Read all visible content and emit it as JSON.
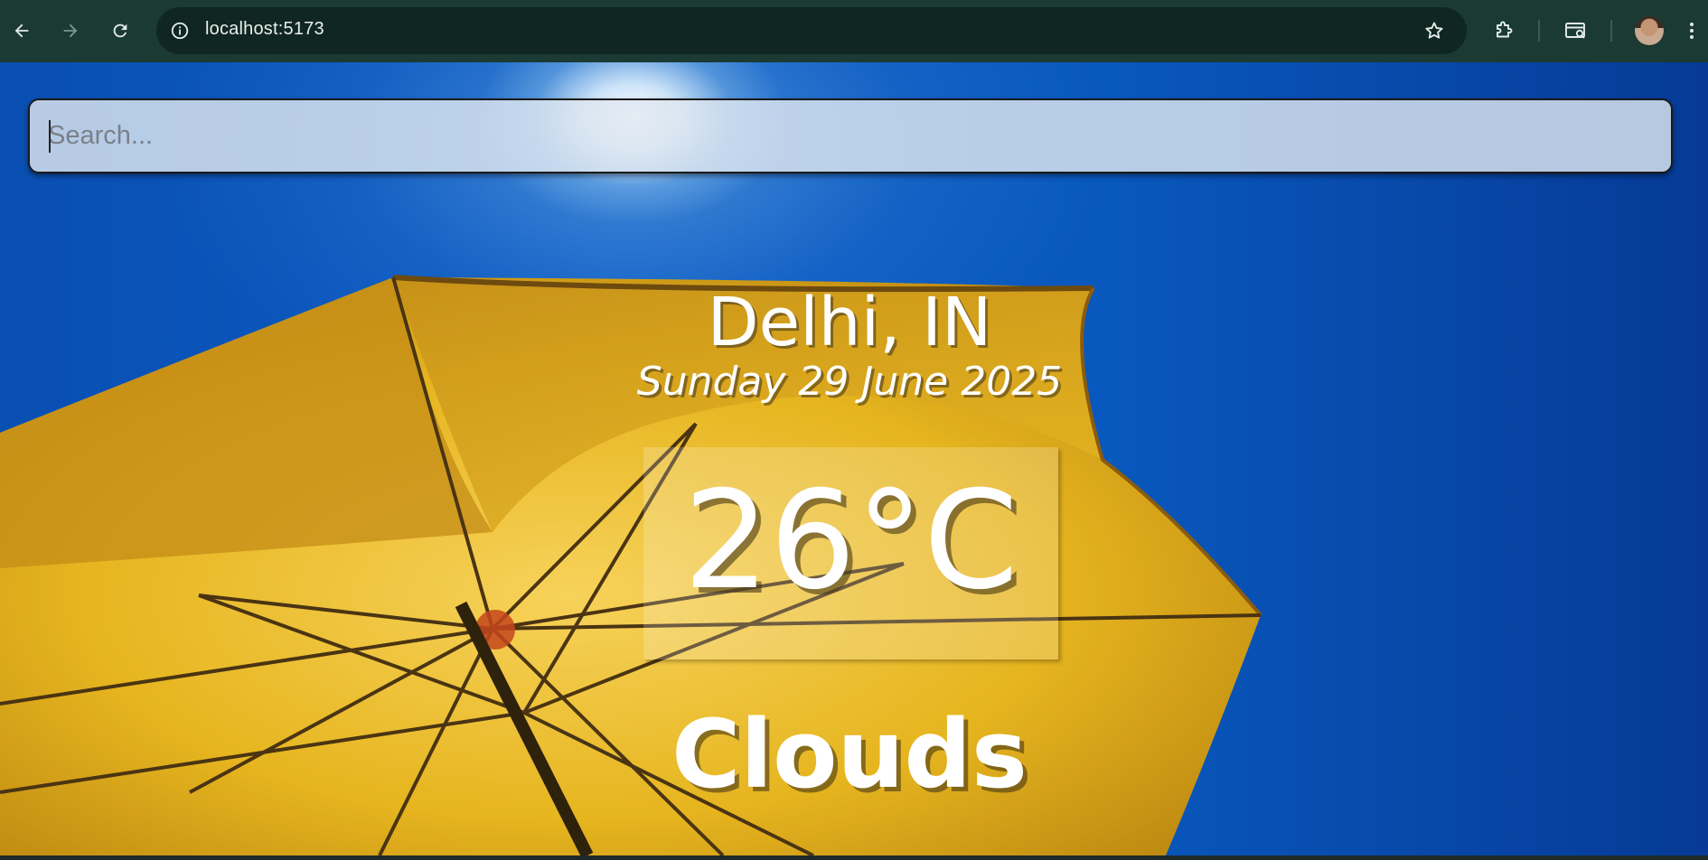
{
  "browser": {
    "url": "localhost:5173",
    "nav": {
      "back_icon": "arrow-left-icon",
      "forward_icon": "arrow-right-icon",
      "reload_icon": "reload-icon"
    },
    "toolbar_icons": [
      "site-info-icon",
      "bookmark-star-icon",
      "extensions-puzzle-icon",
      "tab-search-icon",
      "profile-avatar",
      "more-menu-icon"
    ]
  },
  "app": {
    "search": {
      "placeholder": "Search...",
      "value": ""
    },
    "location": "Delhi, IN",
    "date": "Sunday 29 June 2025",
    "temperature": "26°C",
    "weather": "Clouds"
  },
  "colors": {
    "chrome_bg": "#1b3a33",
    "omnibox_bg": "#0f2621",
    "sky": "#0b5cc4",
    "umbrella": "#e8b81e",
    "text": "#ffffff"
  }
}
